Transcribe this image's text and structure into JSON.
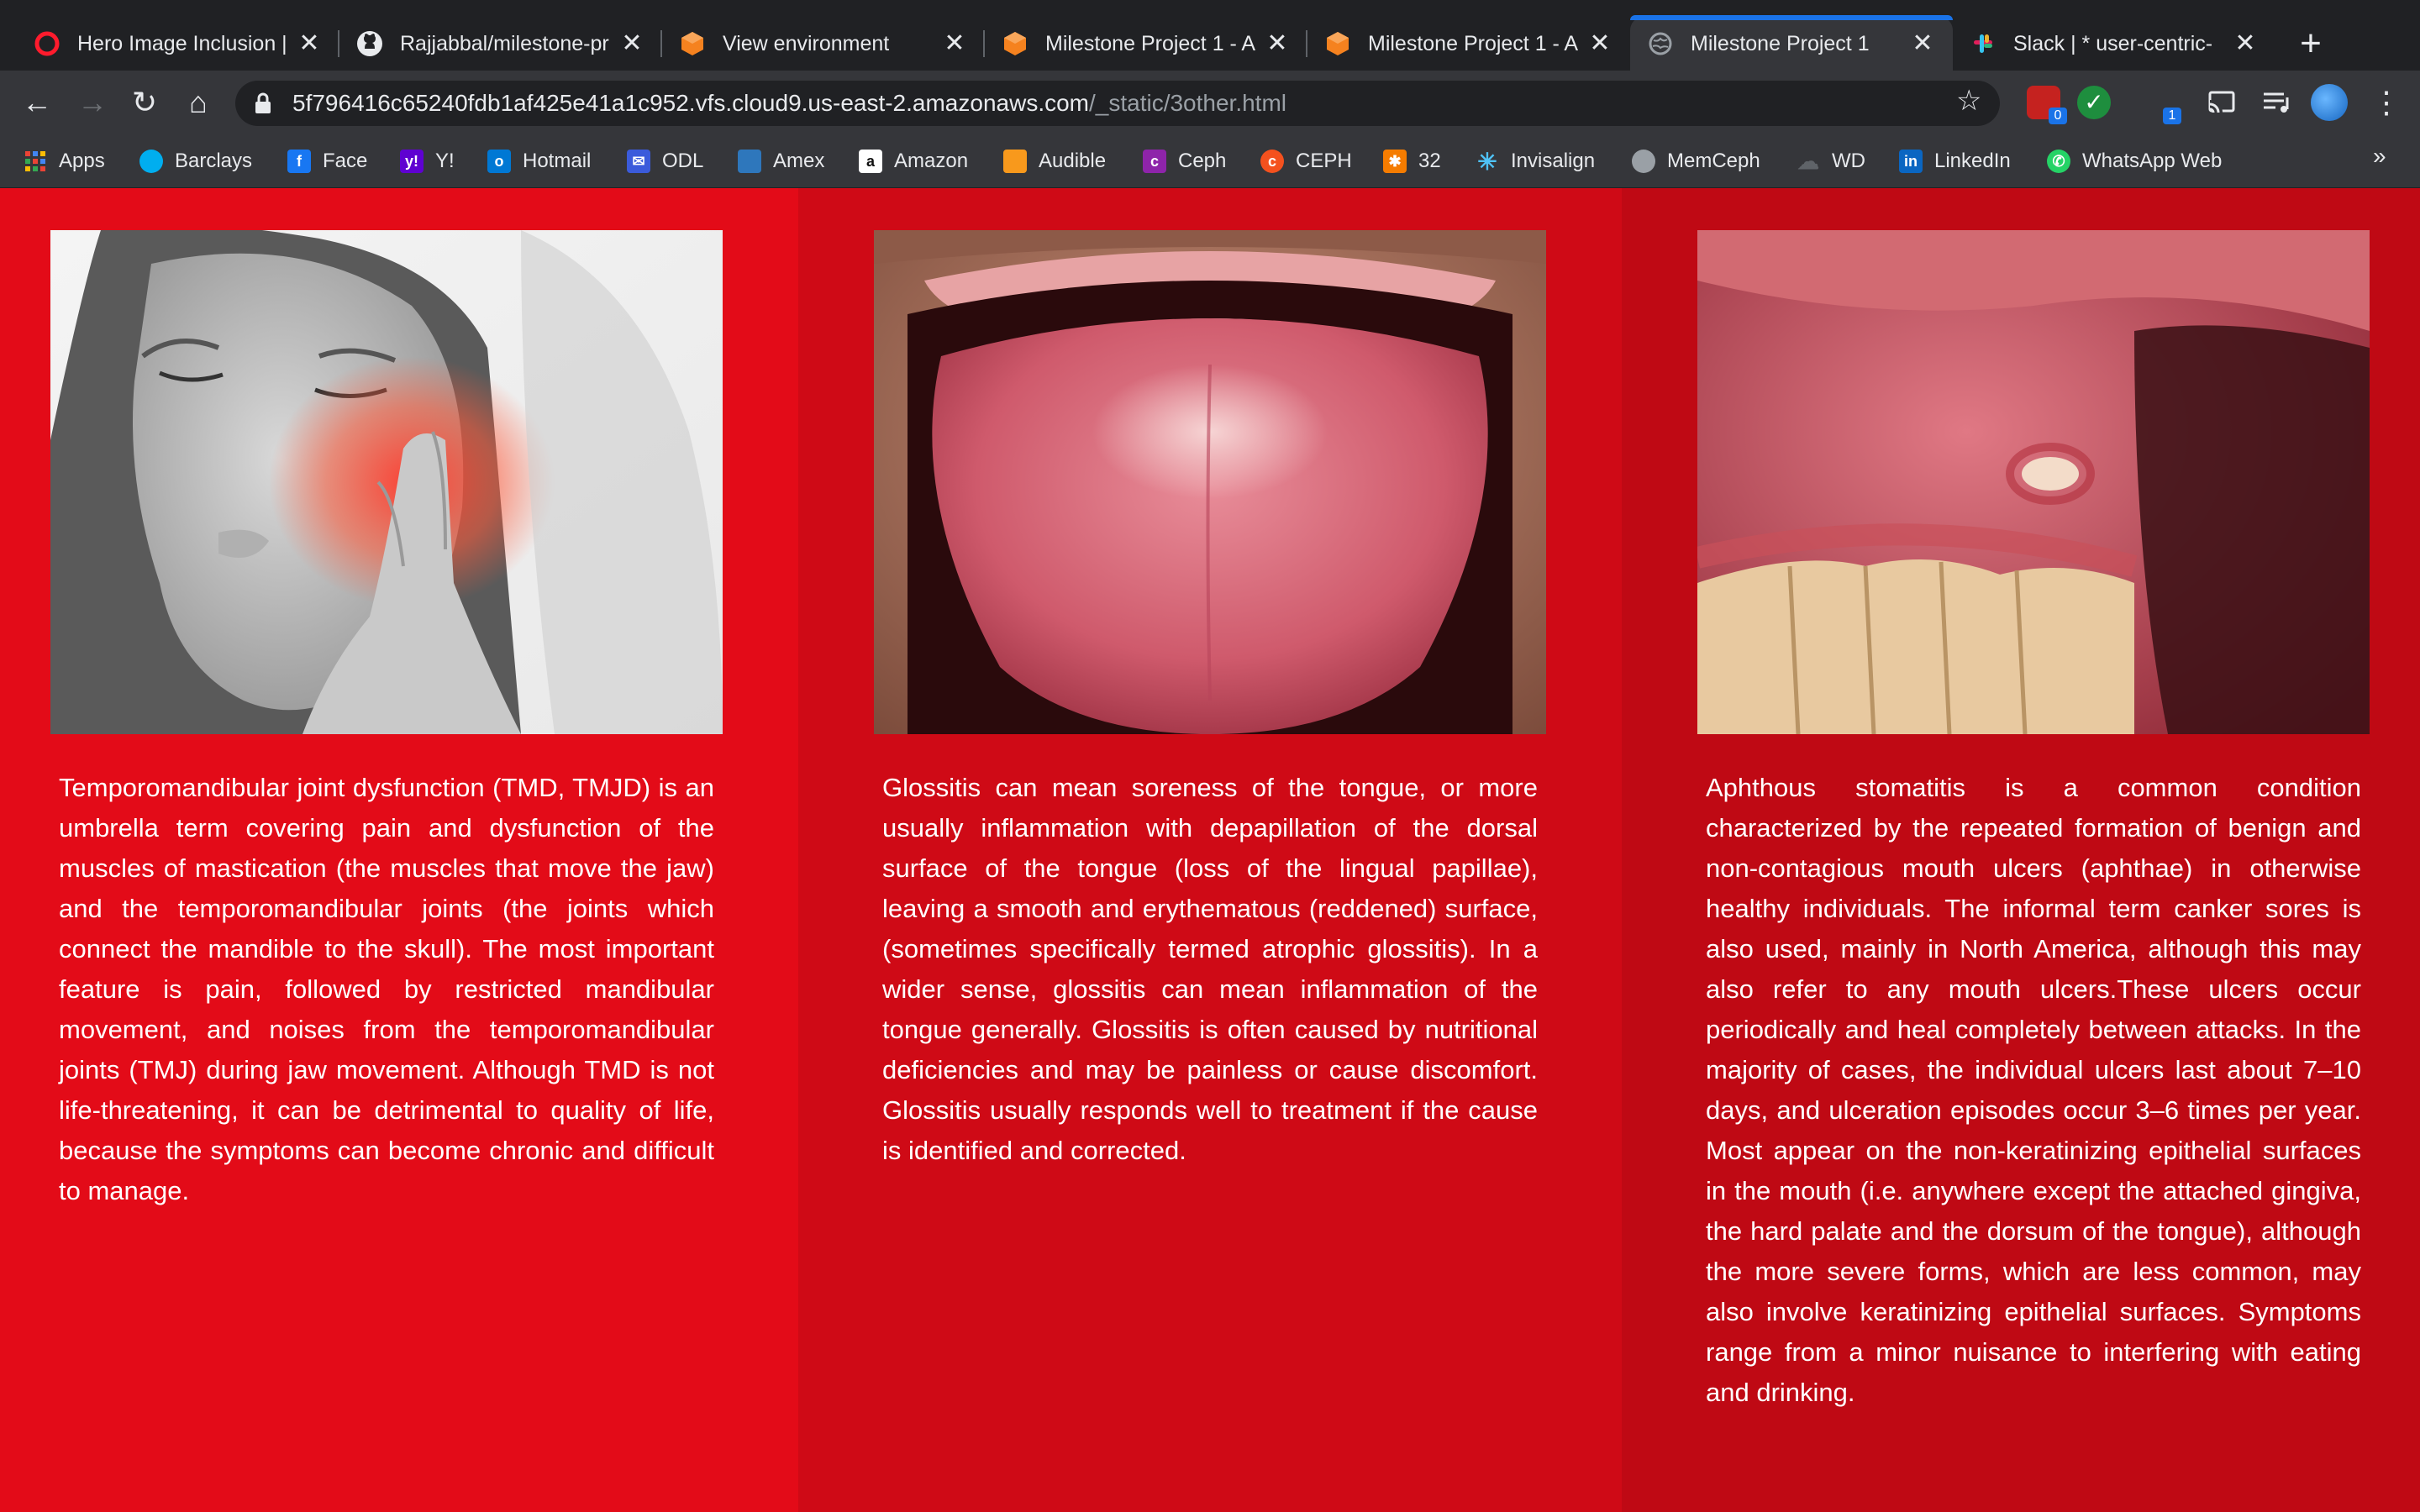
{
  "tabs": [
    {
      "title": "Hero Image Inclusion |",
      "icon": "opera-icon"
    },
    {
      "title": "Rajjabbal/milestone-pr",
      "icon": "github-icon"
    },
    {
      "title": "View environment",
      "icon": "aws-cloud9-icon"
    },
    {
      "title": "Milestone Project 1 - A",
      "icon": "aws-cloud9-icon"
    },
    {
      "title": "Milestone Project 1 - A",
      "icon": "aws-cloud9-icon"
    },
    {
      "title": "Milestone Project 1",
      "icon": "globe-icon",
      "active": true
    },
    {
      "title": "Slack | * user-centric-",
      "icon": "slack-icon"
    }
  ],
  "address": {
    "host": "5f796416c65240fdb1af425e41a1c952.vfs.cloud9.us-east-2.amazonaws.com",
    "path": "/_static/3other.html"
  },
  "extensions": {
    "badge1": "0",
    "badge2": "1"
  },
  "bookmarks": [
    {
      "label": "Apps",
      "icon": "apps-grid-icon"
    },
    {
      "label": "Barclays",
      "icon": "barclays-eagle-icon"
    },
    {
      "label": "Face",
      "icon": "facebook-icon"
    },
    {
      "label": "Y!",
      "icon": "yahoo-icon"
    },
    {
      "label": "Hotmail",
      "icon": "outlook-icon"
    },
    {
      "label": "ODL",
      "icon": "mail-icon"
    },
    {
      "label": "Amex",
      "icon": "amex-icon"
    },
    {
      "label": "Amazon",
      "icon": "amazon-icon"
    },
    {
      "label": "Audible",
      "icon": "audible-icon"
    },
    {
      "label": "Ceph",
      "icon": "ceph-icon"
    },
    {
      "label": "CEPH",
      "icon": "ceph-orange-icon"
    },
    {
      "label": "32",
      "icon": "puzzle-icon"
    },
    {
      "label": "Invisalign",
      "icon": "invisalign-icon"
    },
    {
      "label": "MemCeph",
      "icon": "memceph-icon"
    },
    {
      "label": "WD",
      "icon": "cloud-icon"
    },
    {
      "label": "LinkedIn",
      "icon": "linkedin-icon"
    },
    {
      "label": "WhatsApp Web",
      "icon": "whatsapp-icon"
    }
  ],
  "bookmarks_more": "»",
  "colors": {
    "col1": "#e30b18",
    "col2": "#cf0a16",
    "col3": "#bf0914"
  },
  "articles": [
    {
      "image": "jaw-pain-photo",
      "text": "Temporomandibular joint dysfunction (TMD, TMJD) is an umbrella term covering pain and dysfunction of the muscles of mastication (the muscles that move the jaw) and the temporomandibular joints (the joints which connect the mandible to the skull). The most important feature is pain, followed by restricted mandibular movement, and noises from the temporomandibular joints (TMJ) during jaw movement. Although TMD is not life-threatening, it can be detrimental to quality of life, because the symptoms can become chronic and difficult to manage."
    },
    {
      "image": "tongue-photo",
      "text": "Glossitis can mean soreness of the tongue, or more usually inflammation with depapillation of the dorsal surface of the tongue (loss of the lingual papillae), leaving a smooth and erythematous (reddened) surface, (sometimes specifically termed atrophic glossitis). In a wider sense, glossitis can mean inflammation of the tongue generally. Glossitis is often caused by nutritional deficiencies and may be painless or cause discomfort. Glossitis usually responds well to treatment if the cause is identified and corrected."
    },
    {
      "image": "mouth-ulcer-photo",
      "text": "Aphthous stomatitis is a common condition characterized by the repeated formation of benign and non-contagious mouth ulcers (aphthae) in otherwise healthy individuals. The informal term canker sores is also used, mainly in North America, although this may also refer to any mouth ulcers.These ulcers occur periodically and heal completely between attacks. In the majority of cases, the individual ulcers last about 7–10 days, and ulceration episodes occur 3–6 times per year. Most appear on the non-keratinizing epithelial surfaces in the mouth (i.e. anywhere except the attached gingiva, the hard palate and the dorsum of the tongue), although the more severe forms, which are less common, may also involve keratinizing epithelial surfaces. Symptoms range from a minor nuisance to interfering with eating and drinking."
    }
  ]
}
